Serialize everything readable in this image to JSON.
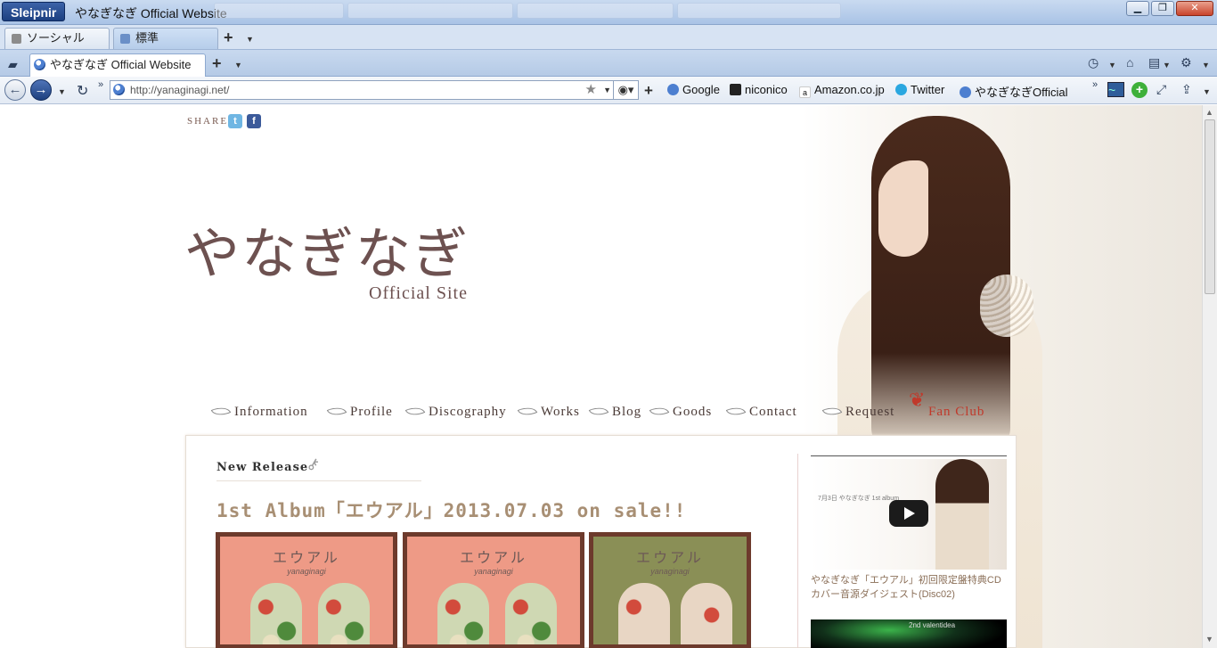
{
  "window": {
    "brand": "Sleipnir",
    "title": "やなぎなぎ Official Website",
    "controls": {
      "minimize": "▁",
      "maximize": "❐",
      "close": "✕"
    }
  },
  "group_tabs": [
    {
      "label": "ソーシャル",
      "color": "#8c8c8c"
    },
    {
      "label": "標準",
      "color": "#6a8fc7"
    }
  ],
  "page_tabs": [
    {
      "label": "やなぎなぎ Official Website"
    }
  ],
  "nav": {
    "address": "http://yanaginagi.net/",
    "bookmarks": [
      {
        "label": "Google",
        "icon": "globe-icon"
      },
      {
        "label": "niconico",
        "icon": "tv-icon"
      },
      {
        "label": "Amazon.co.jp",
        "icon": "amazon-icon"
      },
      {
        "label": "Twitter",
        "icon": "twitter-bird-icon"
      },
      {
        "label": "やなぎなぎOfficial",
        "icon": "globe-icon"
      }
    ]
  },
  "site": {
    "share_label": "SHARE",
    "logo_main": "やなぎなぎ",
    "logo_sub": "Official Site",
    "menu": [
      "Information",
      "Profile",
      "Discography",
      "Works",
      "Blog",
      "Goods",
      "Contact",
      "Request",
      "Fan Club"
    ],
    "section_title": "New Release",
    "headline": "1st Album「エウアル」2013.07.03 on sale!!",
    "covers": [
      {
        "title": "エウアル",
        "sub": "yanaginagi",
        "bg": "#ee9a86"
      },
      {
        "title": "エウアル",
        "sub": "yanaginagi",
        "bg": "#ee9a86"
      },
      {
        "title": "エウアル",
        "sub": "yanaginagi",
        "bg": "#8a8f56"
      }
    ],
    "video_caption": "やなぎなぎ「エウアル」初回限定盤特典CD カバー音源ダイジェスト(Disc02)",
    "video_overlay": "7月3日 やなぎなぎ 1st album",
    "video2_overlay": "2nd valentidea"
  },
  "colors": {
    "accent": "#a88f74",
    "logo": "#6d5150",
    "fanclub": "#c0392b"
  }
}
